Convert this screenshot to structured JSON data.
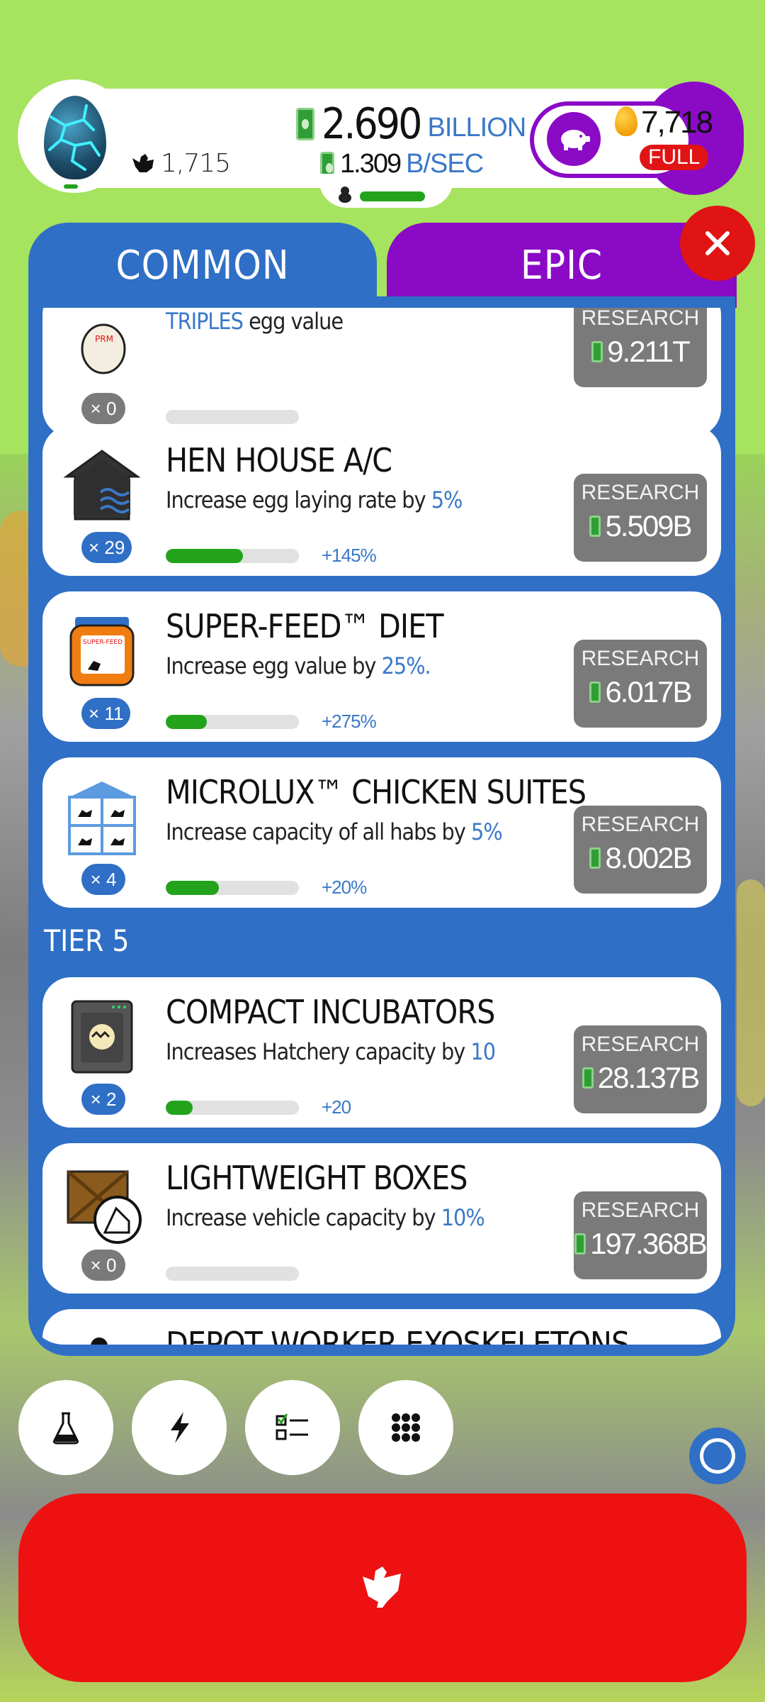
{
  "header": {
    "chicken_count": "1,715",
    "money_amount": "2.690",
    "money_unit": "BILLION",
    "rate_amount": "1.309",
    "rate_unit": "B/SEC",
    "golden_eggs": "7,718",
    "full_label": "FULL"
  },
  "tabs": {
    "common": "COMMON",
    "epic": "EPIC"
  },
  "research_label": "RESEARCH",
  "cards": [
    {
      "title": "",
      "desc_hl": "TRIPLES",
      "desc": " egg value",
      "desc_suffix": "",
      "count": "× 0",
      "bonus": "",
      "progress": 0,
      "price": "9.211T",
      "grey": true
    },
    {
      "title": "HEN HOUSE A/C",
      "desc": "Increase egg laying rate by ",
      "desc_hl": "5%",
      "desc_suffix": "",
      "count": "× 29",
      "bonus": "+145%",
      "progress": 0.58,
      "price": "5.509B",
      "grey": false
    },
    {
      "title": "SUPER-FEED™ DIET",
      "desc": "Increase egg value by ",
      "desc_hl": "25%",
      "desc_suffix": ".",
      "count": "× 11",
      "bonus": "+275%",
      "progress": 0.31,
      "price": "6.017B",
      "grey": false
    },
    {
      "title": "MICROLUX™ CHICKEN SUITES",
      "desc": "Increase capacity of all habs by ",
      "desc_hl": "5%",
      "desc_suffix": "",
      "count": "× 4",
      "bonus": "+20%",
      "progress": 0.4,
      "price": "8.002B",
      "grey": false
    },
    {
      "title": "COMPACT INCUBATORS",
      "desc": "Increases Hatchery capacity by ",
      "desc_hl": "10",
      "desc_suffix": "",
      "count": "× 2",
      "bonus": "+20",
      "progress": 0.2,
      "price": "28.137B",
      "grey": false
    },
    {
      "title": "LIGHTWEIGHT BOXES",
      "desc": "Increase vehicle capacity by ",
      "desc_hl": "10%",
      "desc_suffix": "",
      "count": "× 0",
      "bonus": "",
      "progress": 0,
      "price": "197.368B",
      "grey": true
    },
    {
      "title": "DEPOT WORKER EXOSKELETONS",
      "desc": "",
      "desc_hl": "",
      "desc_suffix": "",
      "count": "",
      "bonus": "",
      "progress": 0,
      "price": "",
      "grey": true
    }
  ],
  "tier_label": "TIER 5",
  "nav_icons": [
    "flask-icon",
    "lightning-icon",
    "checklist-icon",
    "grid-icon"
  ],
  "colors": {
    "panel_blue": "#2f6fc6",
    "epic_purple": "#8a0ac6",
    "hatch_red": "#ee1111",
    "progress_green": "#23a31c"
  }
}
